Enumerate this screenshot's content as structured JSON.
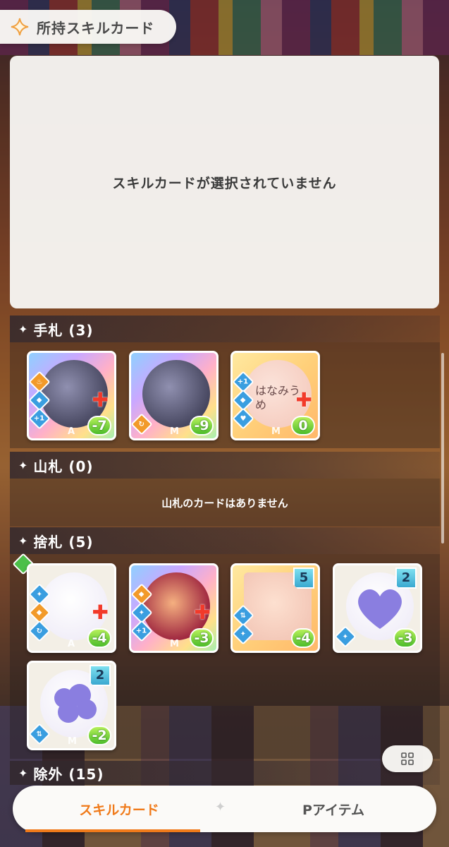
{
  "header": {
    "title": "所持スキルカード"
  },
  "detail": {
    "empty_message": "スキルカードが選択されていません"
  },
  "sections": {
    "hand": {
      "label": "手札 (3)"
    },
    "deck": {
      "label": "山札 (0)",
      "empty_message": "山札のカードはありません"
    },
    "discard": {
      "label": "捨札 (5)"
    },
    "removed": {
      "label": "除外 (15)"
    }
  },
  "hand_cards": [
    {
      "grade": "A",
      "cost": "-7",
      "plus": "✚"
    },
    {
      "grade": "M",
      "cost": "-9"
    },
    {
      "grade": "M",
      "cost": "0",
      "plus": "✚",
      "art_text": "はなみうめ"
    }
  ],
  "discard_cards": [
    {
      "grade": "A",
      "cost": "-4",
      "plus": "✚"
    },
    {
      "grade": "M",
      "cost": "-3",
      "plus": "✚"
    },
    {
      "cost": "-4",
      "level": "5"
    },
    {
      "cost": "-3",
      "level": "2"
    },
    {
      "grade": "M",
      "cost": "-2",
      "level": "2"
    }
  ],
  "tabs": {
    "skill_card": "スキルカード",
    "p_item": "Pアイテム",
    "separator": "✦"
  },
  "colors": {
    "accent": "#f07a1a",
    "panel": "#f6f4f1",
    "cost_green": "#4cbc2a"
  }
}
